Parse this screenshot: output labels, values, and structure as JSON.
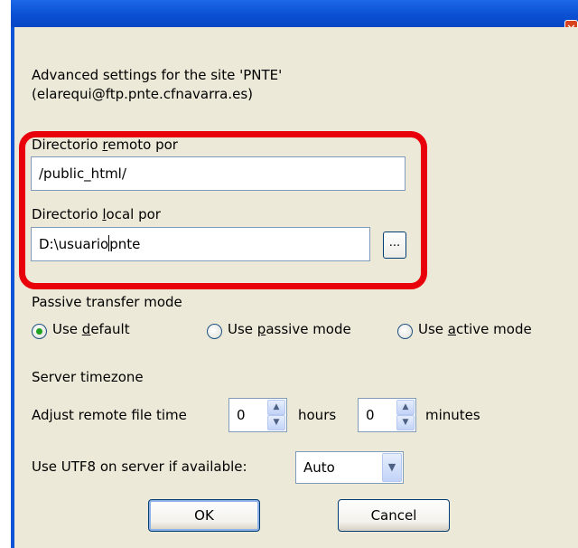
{
  "window": {
    "close_icon_glyph": "✕"
  },
  "header": {
    "line1": "Advanced settings for the site 'PNTE'",
    "line2": "(elarequi@ftp.pnte.cfnavarra.es)"
  },
  "remote_dir": {
    "label_pre": "Directorio ",
    "label_key": "r",
    "label_post": "emoto por",
    "value": "/public_html/"
  },
  "local_dir": {
    "label_pre": "Directorio ",
    "label_key": "l",
    "label_post": "ocal por",
    "value_before_caret": "D:\\usuario",
    "value_after_caret": "pnte",
    "browse_label": "..."
  },
  "passive": {
    "label": "Passive transfer mode",
    "options": [
      {
        "pre": "Use ",
        "key": "d",
        "post": "efault",
        "selected": true
      },
      {
        "pre": "Use ",
        "key": "p",
        "post": "assive mode",
        "selected": false
      },
      {
        "pre": "Use ",
        "key": "a",
        "post": "ctive mode",
        "selected": false
      }
    ]
  },
  "timezone": {
    "section_label": "Server timezone",
    "adjust_label": "Adjust remote file time",
    "hours_value": "0",
    "hours_label": "hours",
    "minutes_value": "0",
    "minutes_label": "minutes"
  },
  "utf8": {
    "label": "Use UTF8 on server if available:",
    "selected": "Auto"
  },
  "buttons": {
    "ok": "OK",
    "cancel": "Cancel"
  },
  "colors": {
    "highlight": "#e8000b",
    "titlebar": "#0a4fd3",
    "dialog_bg": "#ece9d8"
  }
}
